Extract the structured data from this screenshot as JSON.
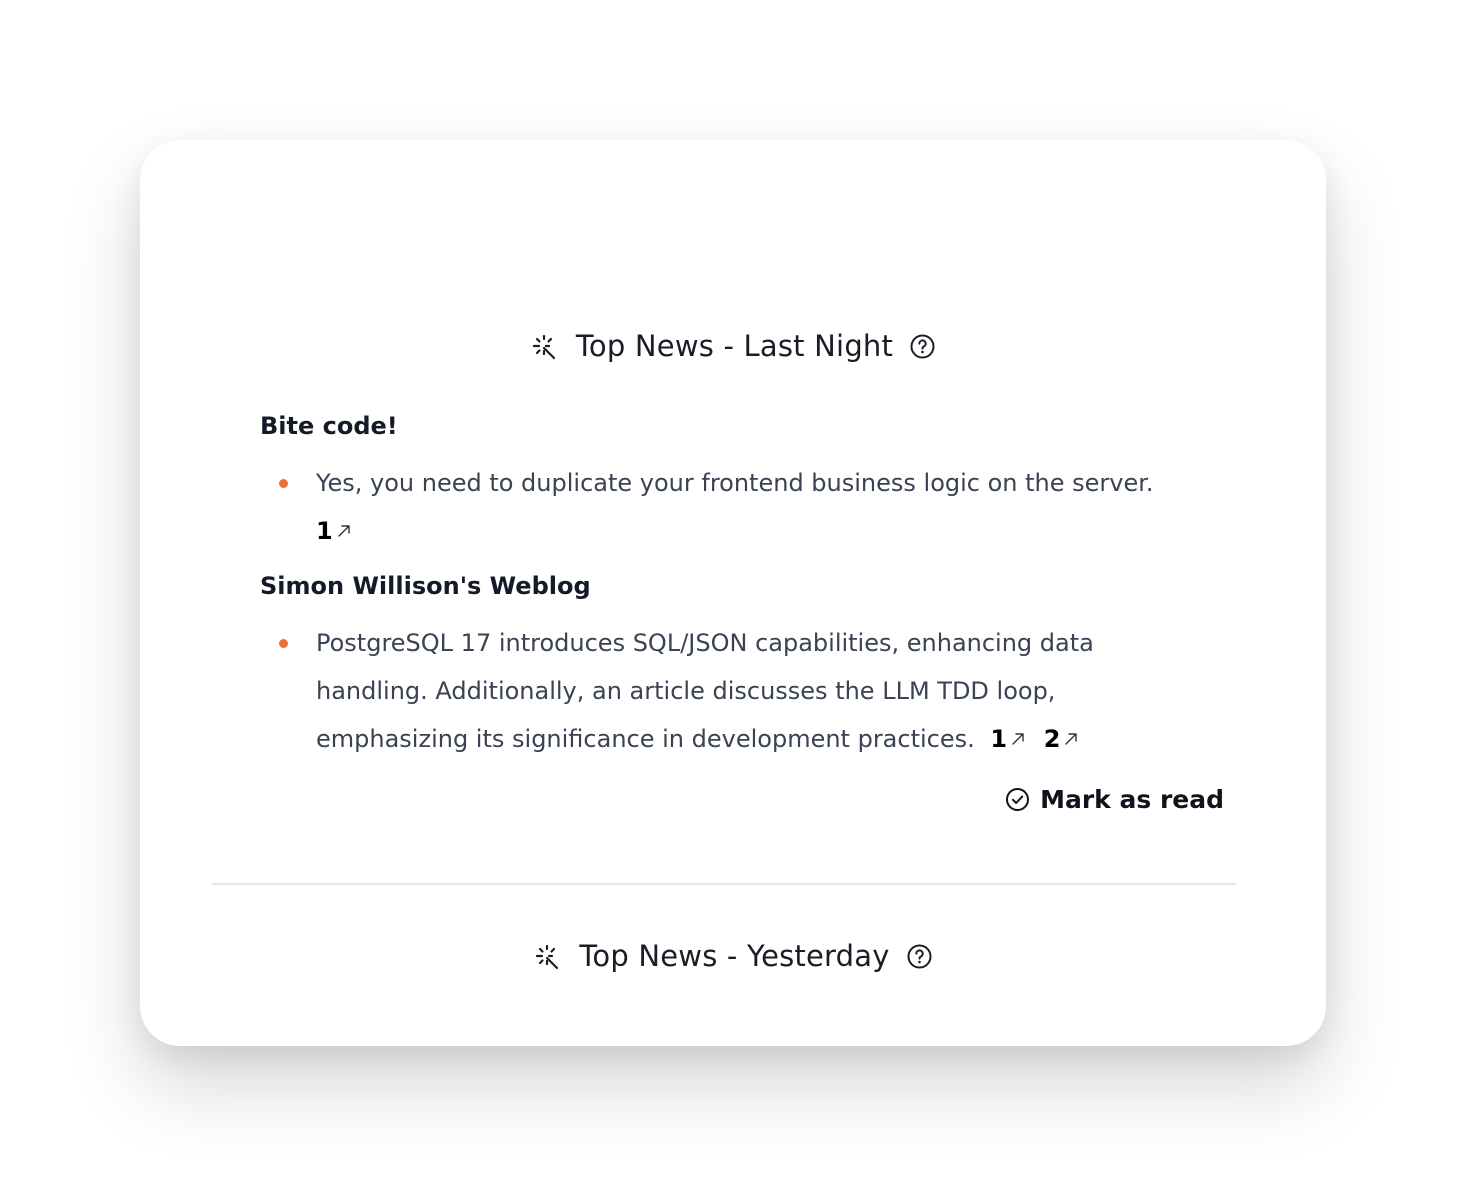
{
  "sections": [
    {
      "title": "Top News - Last Night",
      "groups": [
        {
          "source": "Bite code!",
          "items": [
            {
              "text": "Yes, you need to duplicate your frontend business logic on the server.",
              "refs": [
                "1"
              ]
            }
          ]
        },
        {
          "source": "Simon Willison's Weblog",
          "items": [
            {
              "text": "PostgreSQL 17 introduces SQL/JSON capabilities, enhancing data handling. Additionally, an article discusses the LLM TDD loop, emphasizing its significance in development practices.",
              "refs": [
                "1",
                "2"
              ]
            }
          ]
        }
      ],
      "action_label": "Mark as read"
    },
    {
      "title": "Top News - Yesterday"
    }
  ],
  "colors": {
    "bullet": "#e8733f",
    "heading": "#1a1d26",
    "body_text": "#3a4254",
    "divider": "#e6e7ea"
  },
  "icons": {
    "section_icon": "sparkle-icon",
    "help_icon": "help-icon",
    "ref_icon": "external-arrow-icon",
    "action_icon": "check-circle-icon"
  }
}
